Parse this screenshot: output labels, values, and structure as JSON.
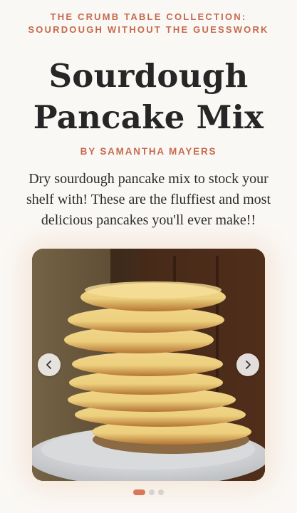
{
  "header": {
    "collection_line1": "THE CRUMB TABLE COLLECTION:",
    "collection_line2": "SOURDOUGH WITHOUT THE GUESSWORK"
  },
  "recipe": {
    "title_line1": "Sourdough",
    "title_line2": "Pancake Mix",
    "author": "BY SAMANTHA MAYERS",
    "description": "Dry sourdough pancake mix to stock your shelf with! These are the fluffiest and most delicious pancakes you'll ever make!!"
  },
  "carousel": {
    "image_alt": "Stack of fluffy sourdough pancakes on a white plate",
    "prev_icon": "chevron-left-icon",
    "next_icon": "chevron-right-icon",
    "slide_count": 3,
    "active_slide": 0
  },
  "colors": {
    "accent": "#c66a4e",
    "background": "#faf8f5",
    "title": "#262626",
    "dot_active": "#d9775a",
    "dot_inactive": "#d6d3cf"
  }
}
